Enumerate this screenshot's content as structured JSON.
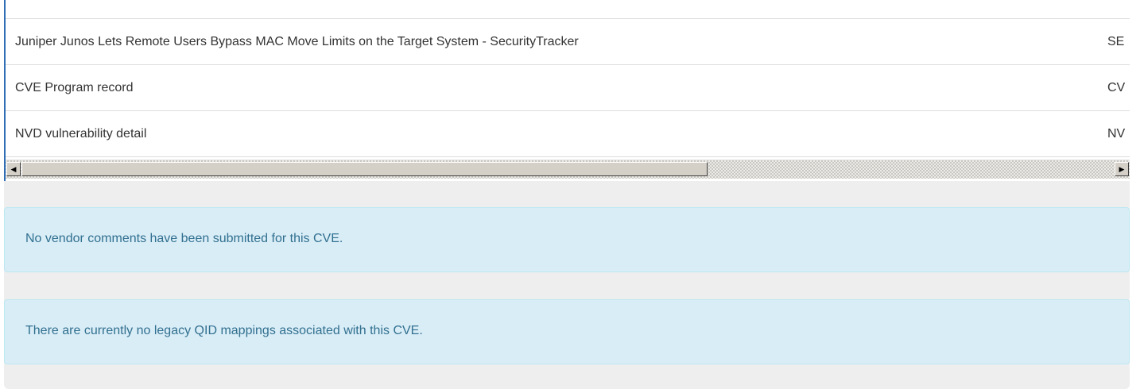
{
  "references_table": {
    "rows": [
      {
        "title": "",
        "source": ""
      },
      {
        "title": "Juniper Junos Lets Remote Users Bypass MAC Move Limits on the Target System - SecurityTracker",
        "source": "SE"
      },
      {
        "title": "CVE Program record",
        "source": "CV"
      },
      {
        "title": "NVD vulnerability detail",
        "source": "NV"
      }
    ],
    "scrollbar": {
      "left_arrow_icon": "scroll-left-arrow",
      "right_arrow_icon": "scroll-right-arrow",
      "left_arrow_glyph": "◀",
      "right_arrow_glyph": "▶"
    }
  },
  "vendor_comments": {
    "message": "No vendor comments have been submitted for this CVE."
  },
  "legacy_qid": {
    "message": "There are currently no legacy QID mappings associated with this CVE."
  },
  "colors": {
    "alert_bg": "#d9edf7",
    "alert_text": "#31708f",
    "accent_border": "#2f6db5",
    "panel_bg": "#eeeeee"
  }
}
